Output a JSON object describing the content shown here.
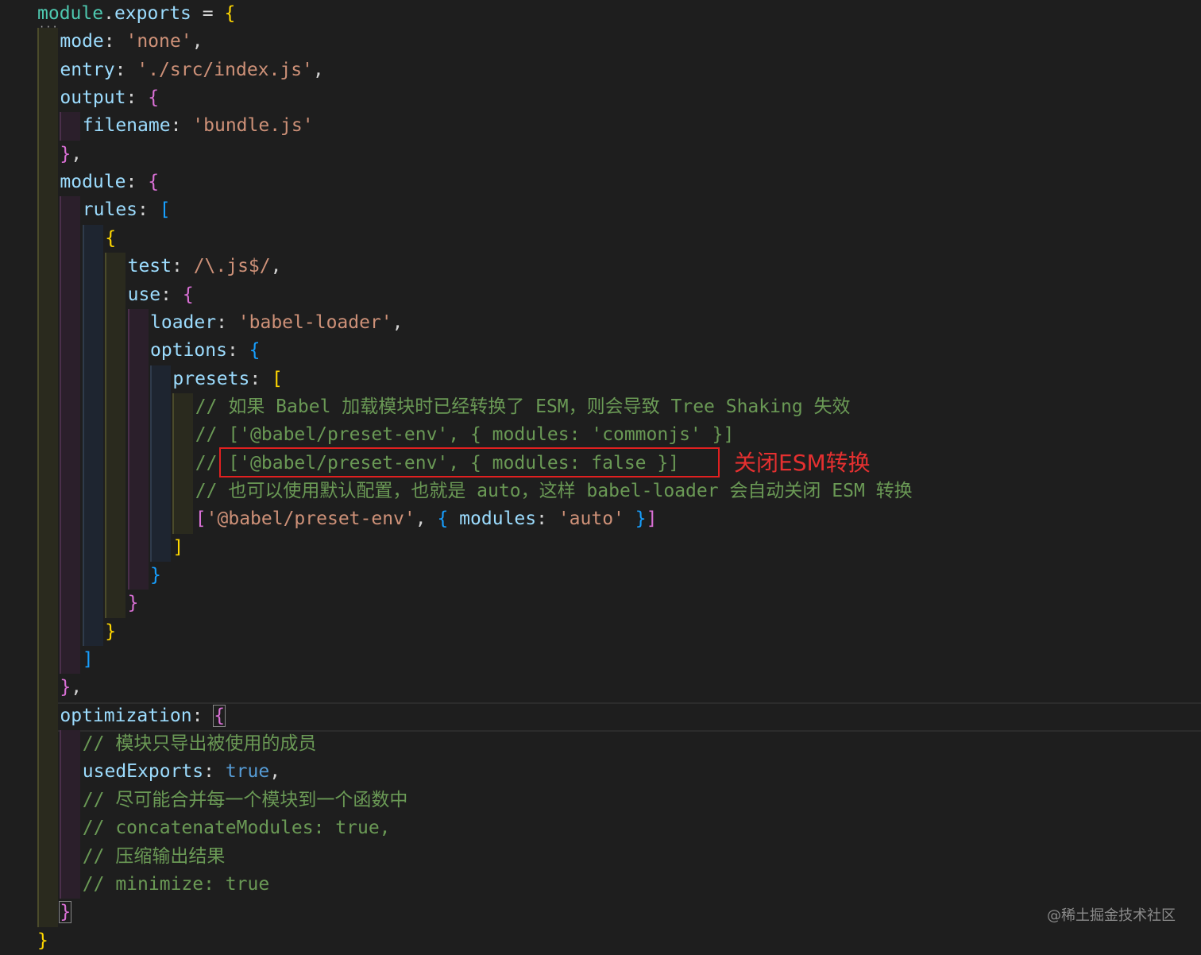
{
  "code_lines": [
    {
      "indent": 0,
      "tokens": [
        {
          "t": "module",
          "c": "tok-ident"
        },
        {
          "t": ".",
          "c": "tok-punc"
        },
        {
          "t": "exports",
          "c": "tok-prop"
        },
        {
          "t": " = ",
          "c": "tok-punc"
        },
        {
          "t": "{",
          "c": "b1"
        }
      ]
    },
    {
      "indent": 1,
      "tokens": [
        {
          "t": "mode",
          "c": "tok-prop"
        },
        {
          "t": ": ",
          "c": "tok-punc"
        },
        {
          "t": "'none'",
          "c": "tok-str"
        },
        {
          "t": ",",
          "c": "tok-punc"
        }
      ]
    },
    {
      "indent": 1,
      "tokens": [
        {
          "t": "entry",
          "c": "tok-prop"
        },
        {
          "t": ": ",
          "c": "tok-punc"
        },
        {
          "t": "'./src/index.js'",
          "c": "tok-str"
        },
        {
          "t": ",",
          "c": "tok-punc"
        }
      ]
    },
    {
      "indent": 1,
      "tokens": [
        {
          "t": "output",
          "c": "tok-prop"
        },
        {
          "t": ": ",
          "c": "tok-punc"
        },
        {
          "t": "{",
          "c": "b2"
        }
      ]
    },
    {
      "indent": 2,
      "tokens": [
        {
          "t": "filename",
          "c": "tok-prop"
        },
        {
          "t": ": ",
          "c": "tok-punc"
        },
        {
          "t": "'bundle.js'",
          "c": "tok-str"
        }
      ]
    },
    {
      "indent": 1,
      "tokens": [
        {
          "t": "}",
          "c": "b2"
        },
        {
          "t": ",",
          "c": "tok-punc"
        }
      ]
    },
    {
      "indent": 1,
      "tokens": [
        {
          "t": "module",
          "c": "tok-prop"
        },
        {
          "t": ": ",
          "c": "tok-punc"
        },
        {
          "t": "{",
          "c": "b2"
        }
      ]
    },
    {
      "indent": 2,
      "tokens": [
        {
          "t": "rules",
          "c": "tok-prop"
        },
        {
          "t": ": ",
          "c": "tok-punc"
        },
        {
          "t": "[",
          "c": "b3"
        }
      ]
    },
    {
      "indent": 3,
      "tokens": [
        {
          "t": "{",
          "c": "b1"
        }
      ]
    },
    {
      "indent": 4,
      "tokens": [
        {
          "t": "test",
          "c": "tok-prop"
        },
        {
          "t": ": ",
          "c": "tok-punc"
        },
        {
          "t": "/\\.js$/",
          "c": "tok-str"
        },
        {
          "t": ",",
          "c": "tok-punc"
        }
      ]
    },
    {
      "indent": 4,
      "tokens": [
        {
          "t": "use",
          "c": "tok-prop"
        },
        {
          "t": ": ",
          "c": "tok-punc"
        },
        {
          "t": "{",
          "c": "b2"
        }
      ]
    },
    {
      "indent": 5,
      "tokens": [
        {
          "t": "loader",
          "c": "tok-prop"
        },
        {
          "t": ": ",
          "c": "tok-punc"
        },
        {
          "t": "'babel-loader'",
          "c": "tok-str"
        },
        {
          "t": ",",
          "c": "tok-punc"
        }
      ]
    },
    {
      "indent": 5,
      "tokens": [
        {
          "t": "options",
          "c": "tok-prop"
        },
        {
          "t": ": ",
          "c": "tok-punc"
        },
        {
          "t": "{",
          "c": "b3"
        }
      ]
    },
    {
      "indent": 6,
      "tokens": [
        {
          "t": "presets",
          "c": "tok-prop"
        },
        {
          "t": ": ",
          "c": "tok-punc"
        },
        {
          "t": "[",
          "c": "b1"
        }
      ]
    },
    {
      "indent": 7,
      "tokens": [
        {
          "t": "// 如果 Babel 加载模块时已经转换了 ESM，则会导致 Tree Shaking 失效",
          "c": "tok-com"
        }
      ]
    },
    {
      "indent": 7,
      "tokens": [
        {
          "t": "// ['@babel/preset-env', { modules: 'commonjs' }]",
          "c": "tok-com"
        }
      ]
    },
    {
      "indent": 7,
      "tokens": [
        {
          "t": "// ['@babel/preset-env', { modules: false }]",
          "c": "tok-com"
        }
      ]
    },
    {
      "indent": 7,
      "tokens": [
        {
          "t": "// 也可以使用默认配置，也就是 auto，这样 babel-loader 会自动关闭 ESM 转换",
          "c": "tok-com"
        }
      ]
    },
    {
      "indent": 7,
      "tokens": [
        {
          "t": "[",
          "c": "b2"
        },
        {
          "t": "'@babel/preset-env'",
          "c": "tok-str"
        },
        {
          "t": ", ",
          "c": "tok-punc"
        },
        {
          "t": "{",
          "c": "b3"
        },
        {
          "t": " modules",
          "c": "tok-prop"
        },
        {
          "t": ": ",
          "c": "tok-punc"
        },
        {
          "t": "'auto'",
          "c": "tok-str"
        },
        {
          "t": " ",
          "c": "tok-punc"
        },
        {
          "t": "}",
          "c": "b3"
        },
        {
          "t": "]",
          "c": "b2"
        }
      ]
    },
    {
      "indent": 6,
      "tokens": [
        {
          "t": "]",
          "c": "b1"
        }
      ]
    },
    {
      "indent": 5,
      "tokens": [
        {
          "t": "}",
          "c": "b3"
        }
      ]
    },
    {
      "indent": 4,
      "tokens": [
        {
          "t": "}",
          "c": "b2"
        }
      ]
    },
    {
      "indent": 3,
      "tokens": [
        {
          "t": "}",
          "c": "b1"
        }
      ]
    },
    {
      "indent": 2,
      "tokens": [
        {
          "t": "]",
          "c": "b3"
        }
      ]
    },
    {
      "indent": 1,
      "tokens": [
        {
          "t": "}",
          "c": "b2"
        },
        {
          "t": ",",
          "c": "tok-punc"
        }
      ]
    },
    {
      "indent": 1,
      "tokens": [
        {
          "t": "optimization",
          "c": "tok-prop"
        },
        {
          "t": ": ",
          "c": "tok-punc"
        },
        {
          "t": "{",
          "c": "b2 bracket-match"
        }
      ]
    },
    {
      "indent": 2,
      "tokens": [
        {
          "t": "// 模块只导出被使用的成员",
          "c": "tok-com"
        }
      ]
    },
    {
      "indent": 2,
      "tokens": [
        {
          "t": "usedExports",
          "c": "tok-prop"
        },
        {
          "t": ": ",
          "c": "tok-punc"
        },
        {
          "t": "true",
          "c": "tok-bool"
        },
        {
          "t": ",",
          "c": "tok-punc"
        }
      ]
    },
    {
      "indent": 2,
      "tokens": [
        {
          "t": "// 尽可能合并每一个模块到一个函数中",
          "c": "tok-com"
        }
      ]
    },
    {
      "indent": 2,
      "tokens": [
        {
          "t": "// concatenateModules: true,",
          "c": "tok-com"
        }
      ]
    },
    {
      "indent": 2,
      "tokens": [
        {
          "t": "// 压缩输出结果",
          "c": "tok-com"
        }
      ]
    },
    {
      "indent": 2,
      "tokens": [
        {
          "t": "// minimize: true",
          "c": "tok-com"
        }
      ]
    },
    {
      "indent": 1,
      "tokens": [
        {
          "t": "}",
          "c": "b2 bracket-match"
        }
      ]
    },
    {
      "indent": 0,
      "tokens": [
        {
          "t": "}",
          "c": "b1"
        }
      ]
    }
  ],
  "annotation": {
    "text": "关闭ESM转换",
    "color": "#e53030"
  },
  "watermark": {
    "text": "@稀土掘金技术社区"
  },
  "theme": {
    "background": "#1e1e1e",
    "guide_colors": [
      "#2a2a1e",
      "#2b1f2b",
      "#1e2530",
      "#2a2a1e",
      "#2b1f2b",
      "#1e2530",
      "#2a2a1e"
    ],
    "guide_line_colors": [
      "#4b4b2a",
      "#4b2f4b",
      "#2f3b4b",
      "#4b4b2a",
      "#4b2f4b",
      "#2f3b4b",
      "#4b4b2a"
    ]
  }
}
